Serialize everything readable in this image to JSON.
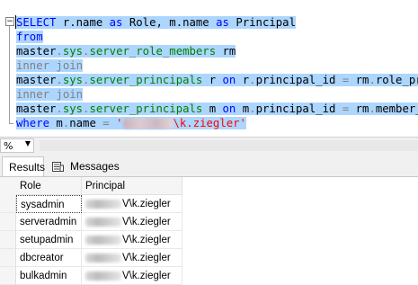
{
  "editor": {
    "lines": [
      {
        "parts": [
          {
            "t": "SELECT",
            "c": "kw"
          },
          {
            "t": " r.name ",
            "c": "blk"
          },
          {
            "t": "as",
            "c": "kw"
          },
          {
            "t": " Role, m.name ",
            "c": "blk"
          },
          {
            "t": "as",
            "c": "kw"
          },
          {
            "t": " Principal",
            "c": "blk"
          }
        ]
      },
      {
        "parts": [
          {
            "t": "from",
            "c": "kw"
          }
        ]
      },
      {
        "parts": [
          {
            "t": "master",
            "c": "blk"
          },
          {
            "t": ".",
            "c": "gray"
          },
          {
            "t": "sys",
            "c": "green"
          },
          {
            "t": ".",
            "c": "gray"
          },
          {
            "t": "server_role_members",
            "c": "green"
          },
          {
            "t": " rm",
            "c": "blk"
          }
        ]
      },
      {
        "parts": [
          {
            "t": "inner join",
            "c": "gray"
          }
        ]
      },
      {
        "parts": [
          {
            "t": "master",
            "c": "blk"
          },
          {
            "t": ".",
            "c": "gray"
          },
          {
            "t": "sys",
            "c": "green"
          },
          {
            "t": ".",
            "c": "gray"
          },
          {
            "t": "server_principals",
            "c": "green"
          },
          {
            "t": " r ",
            "c": "blk"
          },
          {
            "t": "on",
            "c": "kw"
          },
          {
            "t": " r",
            "c": "blk"
          },
          {
            "t": ".",
            "c": "gray"
          },
          {
            "t": "principal_id ",
            "c": "blk"
          },
          {
            "t": "=",
            "c": "gray"
          },
          {
            "t": " rm",
            "c": "blk"
          },
          {
            "t": ".",
            "c": "gray"
          },
          {
            "t": "role_princ",
            "c": "blk"
          }
        ]
      },
      {
        "parts": [
          {
            "t": "inner join",
            "c": "gray"
          }
        ]
      },
      {
        "parts": [
          {
            "t": "master",
            "c": "blk"
          },
          {
            "t": ".",
            "c": "gray"
          },
          {
            "t": "sys",
            "c": "green"
          },
          {
            "t": ".",
            "c": "gray"
          },
          {
            "t": "server_principals",
            "c": "green"
          },
          {
            "t": " m ",
            "c": "blk"
          },
          {
            "t": "on",
            "c": "kw"
          },
          {
            "t": " m",
            "c": "blk"
          },
          {
            "t": ".",
            "c": "gray"
          },
          {
            "t": "principal_id ",
            "c": "blk"
          },
          {
            "t": "=",
            "c": "gray"
          },
          {
            "t": " rm",
            "c": "blk"
          },
          {
            "t": ".",
            "c": "gray"
          },
          {
            "t": "member_pri",
            "c": "blk"
          }
        ]
      },
      {
        "parts": [
          {
            "t": "where",
            "c": "kw"
          },
          {
            "t": " m",
            "c": "blk"
          },
          {
            "t": ".",
            "c": "gray"
          },
          {
            "t": "name ",
            "c": "blk"
          },
          {
            "t": "=",
            "c": "gray"
          },
          {
            "t": " '",
            "c": "red"
          },
          {
            "t": "",
            "c": "blurred"
          },
          {
            "t": "\\k.ziegler'",
            "c": "red"
          }
        ]
      }
    ]
  },
  "zoom": {
    "value": "%"
  },
  "tabs": [
    {
      "label": "Results",
      "icon": "grid-icon"
    },
    {
      "label": "Messages",
      "icon": "messages-icon"
    }
  ],
  "grid": {
    "columns": [
      "Role",
      "Principal"
    ],
    "rows": [
      {
        "role": "sysadmin",
        "principal": "V\\k.ziegler"
      },
      {
        "role": "serveradmin",
        "principal": "V\\k.ziegler"
      },
      {
        "role": "setupadmin",
        "principal": "V\\k.ziegler"
      },
      {
        "role": "dbcreator",
        "principal": "V\\k.ziegler"
      },
      {
        "role": "bulkadmin",
        "principal": "V\\k.ziegler"
      }
    ]
  },
  "colors": {
    "selection": "#add6ff",
    "keyword": "#0000ff",
    "string": "#ff0000",
    "system": "#008000"
  }
}
